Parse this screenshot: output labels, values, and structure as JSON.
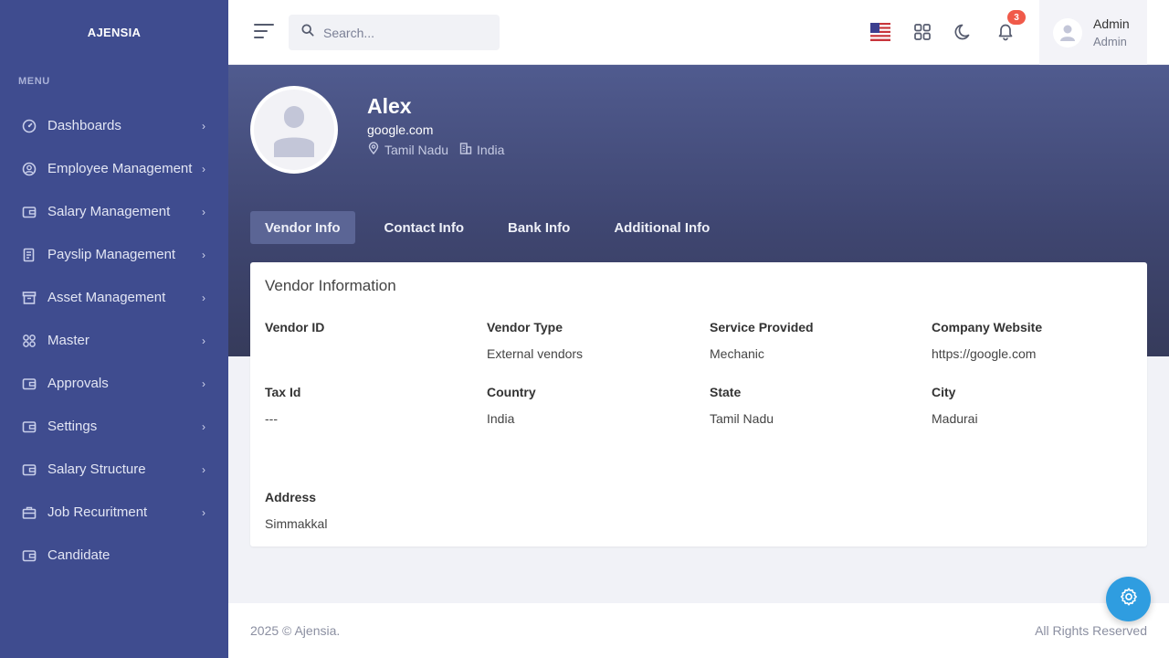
{
  "brand": "AJENSIA",
  "sidebar": {
    "menu_title": "MENU",
    "items": [
      {
        "label": "Dashboards",
        "icon": "gauge-icon",
        "has_children": true
      },
      {
        "label": "Employee Management",
        "icon": "user-circle-icon",
        "has_children": true
      },
      {
        "label": "Salary Management",
        "icon": "wallet-icon",
        "has_children": true
      },
      {
        "label": "Payslip Management",
        "icon": "file-list-icon",
        "has_children": true
      },
      {
        "label": "Asset Management",
        "icon": "archive-icon",
        "has_children": true
      },
      {
        "label": "Master",
        "icon": "grid-icon",
        "has_children": true
      },
      {
        "label": "Approvals",
        "icon": "wallet-icon",
        "has_children": true
      },
      {
        "label": "Settings",
        "icon": "wallet-icon",
        "has_children": true
      },
      {
        "label": "Salary Structure",
        "icon": "wallet-icon",
        "has_children": true
      },
      {
        "label": "Job Recuritment",
        "icon": "briefcase-icon",
        "has_children": true
      },
      {
        "label": "Candidate",
        "icon": "wallet-icon",
        "has_children": false
      }
    ]
  },
  "topbar": {
    "search_placeholder": "Search...",
    "notification_count": "3",
    "user_name": "Admin",
    "user_role": "Admin"
  },
  "profile": {
    "name": "Alex",
    "website": "google.com",
    "state": "Tamil Nadu",
    "country": "India"
  },
  "tabs": [
    {
      "label": "Vendor Info",
      "active": true
    },
    {
      "label": "Contact Info",
      "active": false
    },
    {
      "label": "Bank Info",
      "active": false
    },
    {
      "label": "Additional Info",
      "active": false
    }
  ],
  "vendor_card": {
    "title": "Vendor Information",
    "fields": {
      "vendor_id": {
        "label": "Vendor ID",
        "value": ""
      },
      "vendor_type": {
        "label": "Vendor Type",
        "value": "External vendors"
      },
      "service_provided": {
        "label": "Service Provided",
        "value": "Mechanic"
      },
      "company_website": {
        "label": "Company Website",
        "value": "https://google.com"
      },
      "tax_id": {
        "label": "Tax Id",
        "value": "---"
      },
      "country": {
        "label": "Country",
        "value": "India"
      },
      "state": {
        "label": "State",
        "value": "Tamil Nadu"
      },
      "city": {
        "label": "City",
        "value": "Madurai"
      },
      "address": {
        "label": "Address",
        "value": "Simmakkal"
      }
    }
  },
  "footer": {
    "left": "2025 © Ajensia.",
    "right": "All Rights Reserved"
  },
  "colors": {
    "sidebar_bg": "#3f4c8f",
    "accent_fab": "#2f9de0",
    "badge": "#f05a4a"
  }
}
